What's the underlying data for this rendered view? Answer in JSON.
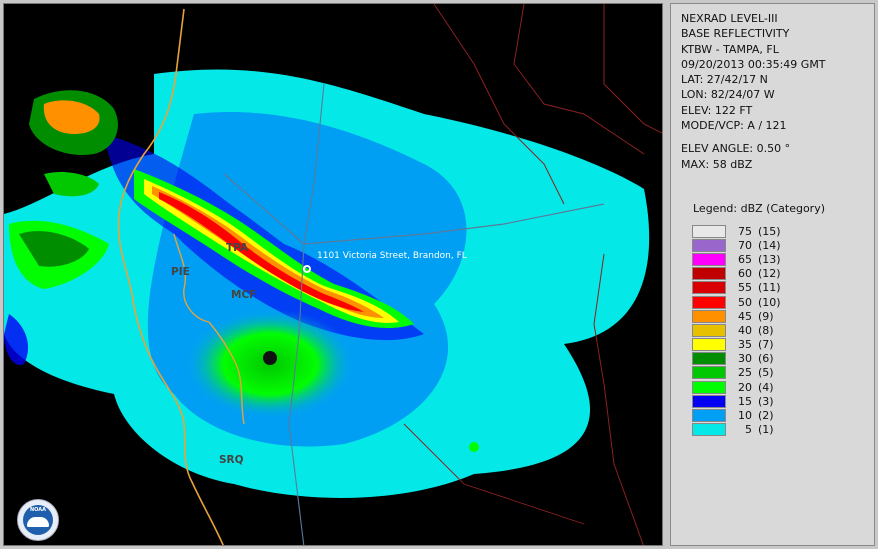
{
  "info": {
    "product": "NEXRAD LEVEL-III",
    "type": "BASE REFLECTIVITY",
    "station": "KTBW - TAMPA, FL",
    "datetime": "09/20/2013 00:35:49 GMT",
    "lat": "LAT: 27/42/17 N",
    "lon": "LON: 82/24/07 W",
    "elev": "ELEV: 122 FT",
    "mode": "MODE/VCP: A / 121",
    "elev_angle": "ELEV ANGLE: 0.50 °",
    "max": "MAX: 58 dBZ"
  },
  "legend": {
    "title": "Legend: dBZ (Category)",
    "items": [
      {
        "value": "75",
        "category": "(15)",
        "color": "#e8e8e8"
      },
      {
        "value": "70",
        "category": "(14)",
        "color": "#9966cc"
      },
      {
        "value": "65",
        "category": "(13)",
        "color": "#ff00ff"
      },
      {
        "value": "60",
        "category": "(12)",
        "color": "#c00000"
      },
      {
        "value": "55",
        "category": "(11)",
        "color": "#d80000"
      },
      {
        "value": "50",
        "category": "(10)",
        "color": "#ff0000"
      },
      {
        "value": "45",
        "category": "(9)",
        "color": "#ff9000"
      },
      {
        "value": "40",
        "category": "(8)",
        "color": "#e7c000"
      },
      {
        "value": "35",
        "category": "(7)",
        "color": "#ffff00"
      },
      {
        "value": "30",
        "category": "(6)",
        "color": "#008e00"
      },
      {
        "value": "25",
        "category": "(5)",
        "color": "#01c801"
      },
      {
        "value": "20",
        "category": "(4)",
        "color": "#02fd02"
      },
      {
        "value": "15",
        "category": "(3)",
        "color": "#0300f4"
      },
      {
        "value": "10",
        "category": "(2)",
        "color": "#019ff4"
      },
      {
        "value": "5",
        "category": "(1)",
        "color": "#04e9e7"
      }
    ]
  },
  "map": {
    "labels": {
      "tpa": "TPA",
      "pie": "PIE",
      "mcf": "MCF",
      "srq": "SRQ"
    },
    "address": "1101 Victoria Street, Brandon, FL",
    "logo": "NOAA"
  }
}
